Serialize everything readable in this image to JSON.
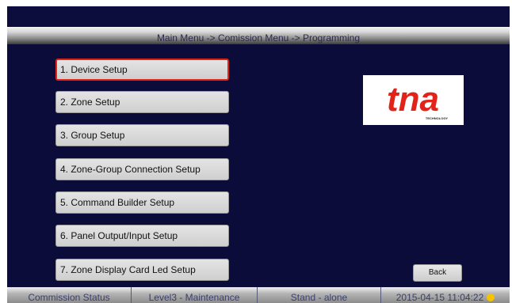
{
  "header": {
    "breadcrumb": "Main Menu -> Comission Menu -> Programming"
  },
  "menu": {
    "selected_index": 0,
    "items": [
      {
        "label": "1. Device Setup"
      },
      {
        "label": "2. Zone Setup"
      },
      {
        "label": "3. Group Setup"
      },
      {
        "label": "4. Zone-Group Connection Setup"
      },
      {
        "label": "5. Command Builder Setup"
      },
      {
        "label": "6. Panel Output/Input Setup"
      },
      {
        "label": "7. Zone Display Card Led Setup"
      }
    ]
  },
  "logo": {
    "text": "tna",
    "subtext": "TECHNOLOGY",
    "color": "#e2231a"
  },
  "actions": {
    "back_label": "Back"
  },
  "status": {
    "commission": "Commission Status",
    "level": "Level3 - Maintenance",
    "mode": "Stand - alone",
    "datetime": "2015-04-15 11:04:22"
  },
  "colors": {
    "screen_bg": "#0b0c3a",
    "selected_border": "#e2231a",
    "indicator": "#f5c400"
  }
}
